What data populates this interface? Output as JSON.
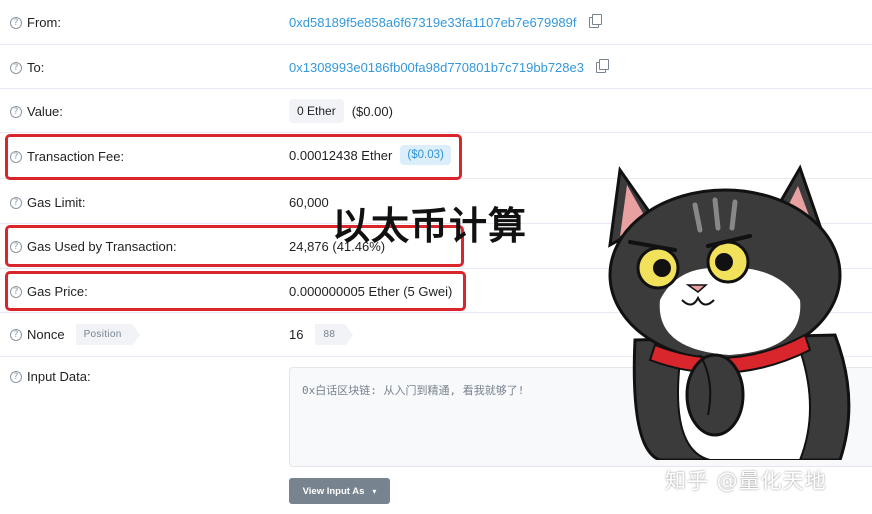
{
  "rows": {
    "from": {
      "label": "From:",
      "value": "0xd58189f5e858a6f67319e33fa1107eb7e679989f"
    },
    "to": {
      "label": "To:",
      "value": "0x1308993e0186fb00fa98d770801b7c719bb728e3"
    },
    "value": {
      "label": "Value:",
      "amount": "0 Ether",
      "usd": "($0.00)"
    },
    "fee": {
      "label": "Transaction Fee:",
      "amount": "0.00012438 Ether",
      "usd": "($0.03)"
    },
    "gas_limit": {
      "label": "Gas Limit:",
      "value": "60,000"
    },
    "gas_used": {
      "label": "Gas Used by Transaction:",
      "value": "24,876 (41.46%)"
    },
    "gas_price": {
      "label": "Gas Price:",
      "value": "0.000000005 Ether (5 Gwei)"
    },
    "nonce": {
      "label": "Nonce",
      "position_tag": "Position",
      "value": "16",
      "position_value": "88"
    },
    "input": {
      "label": "Input Data:",
      "content": "0x白话区块链: 从入门到精通, 看我就够了!",
      "button": "View Input As"
    }
  },
  "overlay_title": "以太币计算",
  "watermark": "知乎 @量化天地",
  "colors": {
    "link": "#3498db",
    "highlight": "#d8262c",
    "fee_badge_bg": "#dbeef9"
  }
}
